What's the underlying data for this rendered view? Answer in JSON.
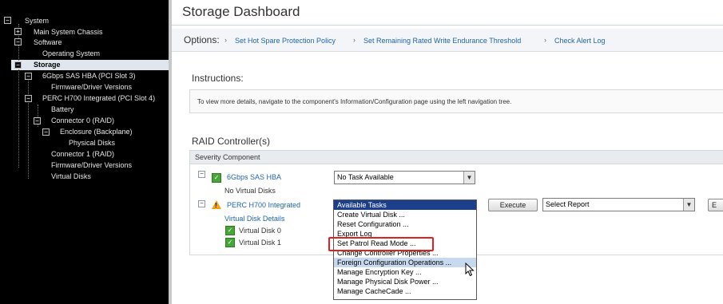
{
  "tree": {
    "items": [
      {
        "label": "System",
        "indent": 0
      },
      {
        "label": "Main System Chassis",
        "indent": 1
      },
      {
        "label": "Software",
        "indent": 1
      },
      {
        "label": "Operating System",
        "indent": 2
      },
      {
        "label": "Storage",
        "indent": 1,
        "selected": true
      },
      {
        "label": "6Gbps SAS HBA (PCI Slot 3)",
        "indent": 2
      },
      {
        "label": "Firmware/Driver Versions",
        "indent": 3
      },
      {
        "label": "PERC H700 Integrated (PCI Slot 4)",
        "indent": 2
      },
      {
        "label": "Battery",
        "indent": 3
      },
      {
        "label": "Connector 0 (RAID)",
        "indent": 3
      },
      {
        "label": "Enclosure (Backplane)",
        "indent": 4
      },
      {
        "label": "Physical Disks",
        "indent": 5
      },
      {
        "label": "Connector 1 (RAID)",
        "indent": 3
      },
      {
        "label": "Firmware/Driver Versions",
        "indent": 3
      },
      {
        "label": "Virtual Disks",
        "indent": 3
      }
    ]
  },
  "page": {
    "title": "Storage Dashboard",
    "options_label": "Options:",
    "options": [
      "Set Hot Spare Protection Policy",
      "Set Remaining Rated Write Endurance Threshold",
      "Check Alert Log"
    ],
    "instructions_title": "Instructions:",
    "instructions_text": "To view more details, navigate to the component's Information/Configuration page using the left navigation tree.",
    "raid_title": "RAID Controller(s)",
    "raid_header": "Severity Component"
  },
  "controllers": {
    "hba": {
      "name": "6Gbps SAS HBA",
      "sub": "No Virtual Disks",
      "task_select": "No Task Available"
    },
    "perc": {
      "name": "PERC H700 Integrated",
      "sub": "Virtual Disk Details",
      "virtual_disks": [
        "Virtual Disk 0",
        "Virtual Disk 1"
      ],
      "execute_label": "Execute",
      "report_select": "Select Report",
      "tasks": [
        "Available Tasks",
        "Create Virtual Disk ...",
        "Reset Configuration ...",
        "Export Log",
        "Set Patrol Read Mode ...",
        "Change Controller Properties ...",
        "Foreign Configuration Operations ...",
        "Manage Encryption Key ...",
        "Manage Physical Disk Power ...",
        "Manage CacheCade ..."
      ],
      "highlighted_task": "Set Patrol Read Mode ...",
      "hovered_task": "Foreign Configuration Operations ..."
    }
  },
  "colors": {
    "link": "#2266aa",
    "list_header": "#1c3f8c",
    "highlight_box": "#e0201e",
    "ok_icon": "#49a53a",
    "warn_icon": "#f0a21a"
  },
  "icons": {
    "tree_expander": "plus-minus-box-icon",
    "ok_status": "green-check-icon",
    "warning_status": "warning-triangle-icon",
    "cursor": "mouse-pointer-icon"
  }
}
